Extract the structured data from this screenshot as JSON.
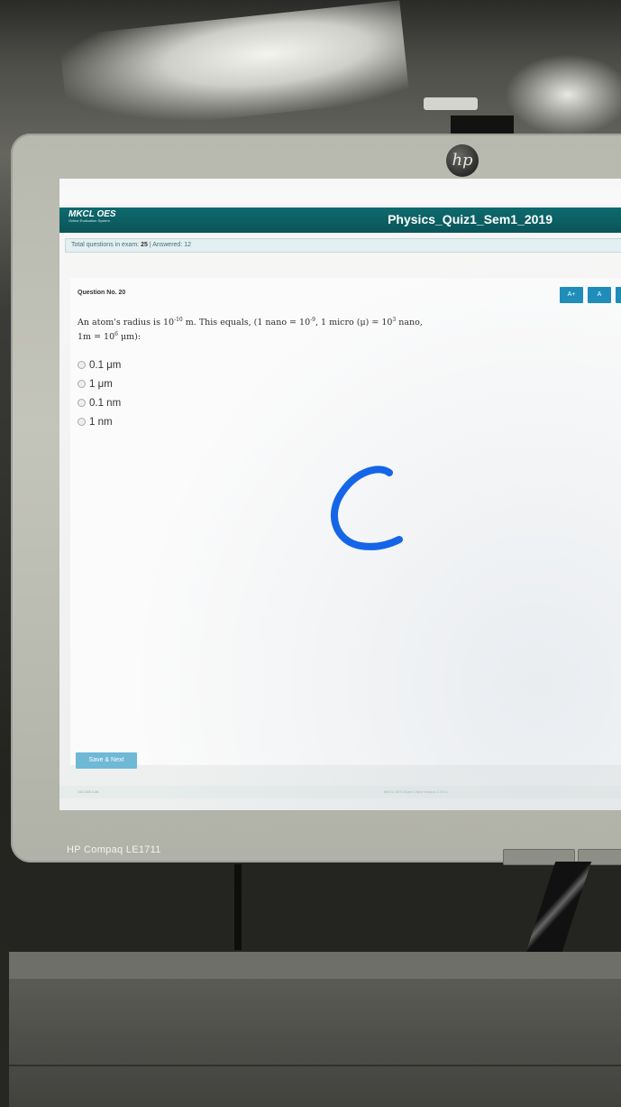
{
  "monitor": {
    "brand_label": "HP Compaq LE1711"
  },
  "app": {
    "logo_text": "MKCL OES",
    "logo_subtext": "Online Evaluation System",
    "exam_title": "Physics_Quiz1_Sem1_2019"
  },
  "status": {
    "total_label": "Total questions in exam:",
    "total_value": "25",
    "answered_label": "| Answered:",
    "answered_value": "12"
  },
  "question": {
    "number_label": "Question No. 20",
    "text_line1": "An atom's radius is 10",
    "exp1": "-10",
    "text_line1b": " m. This equals, (1 nano = 10",
    "exp2": "-9",
    "text_line1c": ", 1 micro (μ) = 10",
    "exp3": "3",
    "text_line1d": " nano,",
    "text_line2a": "1m = 10",
    "exp4": "6",
    "text_line2b": " μm):",
    "options": [
      "0.1 μm",
      "1 μm",
      "0.1 nm",
      "1 nm"
    ]
  },
  "toolbar": {
    "font_increase": "A+",
    "font_normal": "A"
  },
  "actions": {
    "save_next": "Save & Next"
  },
  "footer": {
    "left_text": "192.168.0.36",
    "right_text": "MKCL OES Exam Client Version 2.0.0.1"
  },
  "colors": {
    "header": "#0a5559",
    "button": "#1a8bb8",
    "annotation": "#1565e8"
  }
}
